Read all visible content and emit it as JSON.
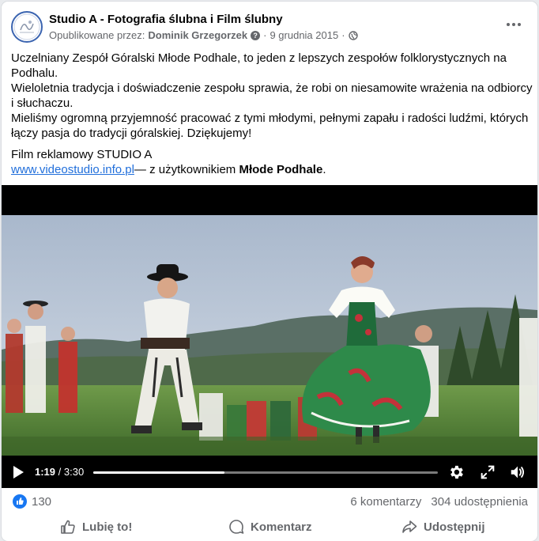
{
  "header": {
    "page_name": "Studio A - Fotografia ślubna i Film ślubny",
    "published_by_label": "Opublikowane przez:",
    "author": "Dominik Grzegorzek",
    "separator": "·",
    "date": "9 grudnia 2015",
    "audience_icon": "globe-icon",
    "more_icon": "more-horizontal-icon"
  },
  "post": {
    "paragraph1": "Uczelniany Zespół Góralski Młode Podhale, to jeden z lepszych zespołów folklorystycznych na Podhalu.",
    "paragraph2": "Wieloletnia tradycja i doświadczenie zespołu sprawia, że robi on niesamowite wrażenia na odbiorcy i słuchaczu.",
    "paragraph3": "Mieliśmy ogromną przyjemność pracować z tymi młodymi, pełnymi zapału i radości ludźmi, których łączy pasja do tradycji góralskiej. Dziękujemy!",
    "film_label": "Film reklamowy STUDIO A",
    "link_text": "www.videostudio.info.pl",
    "with_text": "— z użytkownikiem ",
    "tagged_user": "Młode Podhale",
    "period": "."
  },
  "video": {
    "current_time": "1:19",
    "time_separator": " / ",
    "duration": "3:30",
    "progress_fraction": 0.38,
    "icons": [
      "play-icon",
      "settings-icon",
      "fullscreen-icon",
      "volume-icon"
    ]
  },
  "footer": {
    "like_count": "130",
    "comments": "6 komentarzy",
    "shares": "304 udostępnienia",
    "like_label": "Lubię to!",
    "comment_label": "Komentarz",
    "share_label": "Udostępnij"
  },
  "colors": {
    "link": "#216fdb",
    "like_blue": "#1877f2",
    "muted": "#65676b"
  }
}
